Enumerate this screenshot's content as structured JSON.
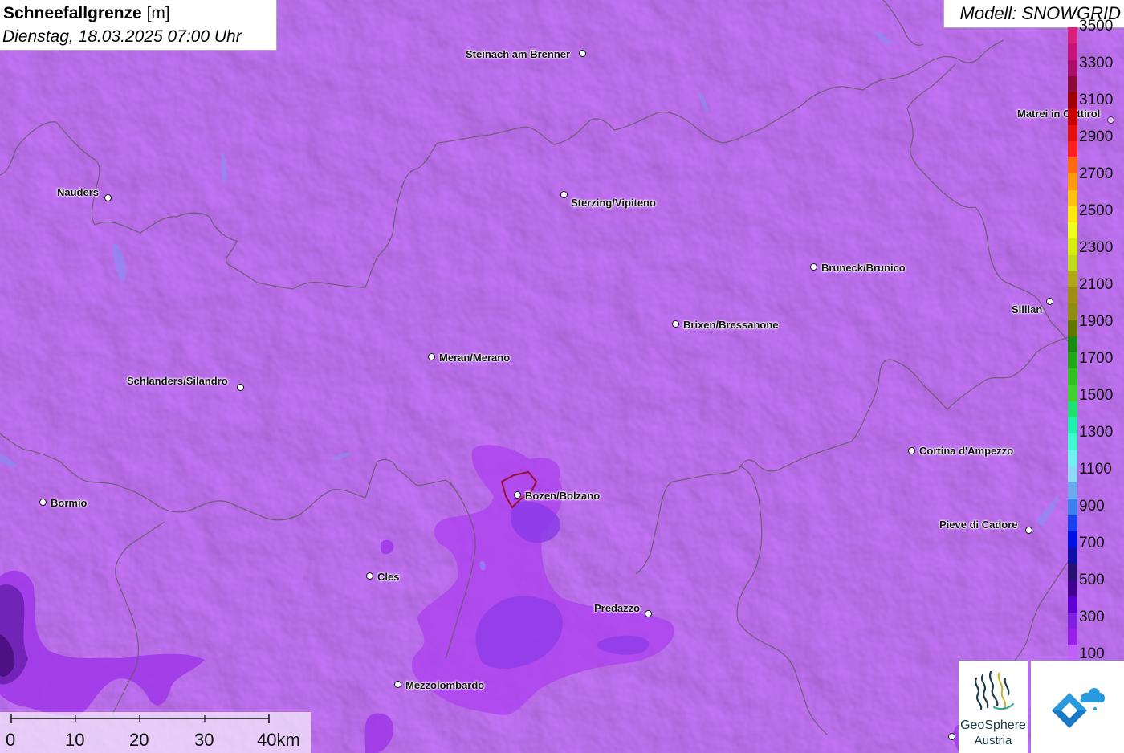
{
  "header": {
    "title_bold": "Schneefallgrenze",
    "title_unit": "[m]",
    "subtitle": "Dienstag, 18.03.2025 07:00 Uhr",
    "model": "Modell: SNOWGRID"
  },
  "cities": [
    {
      "name": "Steinach am Brenner",
      "id": "steinach"
    },
    {
      "name": "Matrei in Osttirol",
      "id": "matrei"
    },
    {
      "name": "Nauders",
      "id": "nauders"
    },
    {
      "name": "Sterzing/Vipiteno",
      "id": "sterzing"
    },
    {
      "name": "Bruneck/Brunico",
      "id": "bruneck"
    },
    {
      "name": "Sillian",
      "id": "sillian"
    },
    {
      "name": "Brixen/Bressanone",
      "id": "brixen"
    },
    {
      "name": "Meran/Merano",
      "id": "meran"
    },
    {
      "name": "Schlanders/Silandro",
      "id": "schlanders"
    },
    {
      "name": "Cortina d'Ampezzo",
      "id": "cortina"
    },
    {
      "name": "Bormio",
      "id": "bormio"
    },
    {
      "name": "Bozen/Bolzano",
      "id": "bozen"
    },
    {
      "name": "Pieve di Cadore",
      "id": "pieve"
    },
    {
      "name": "Cles",
      "id": "cles"
    },
    {
      "name": "Predazzo",
      "id": "predazzo"
    },
    {
      "name": "Mezzolombardo",
      "id": "mezzolombardo"
    }
  ],
  "legend": {
    "labels": [
      "3500",
      "3300",
      "3100",
      "2900",
      "2700",
      "2500",
      "2300",
      "2100",
      "1900",
      "1700",
      "1500",
      "1300",
      "1100",
      "900",
      "700",
      "500",
      "300",
      "100"
    ],
    "colors": [
      "#d8207f",
      "#c4157a",
      "#a80f6a",
      "#8a0a3a",
      "#a00000",
      "#c80000",
      "#e41010",
      "#ff2020",
      "#ff6a10",
      "#ff9a10",
      "#ffc010",
      "#ffe810",
      "#f0ff20",
      "#d8ec10",
      "#c0d820",
      "#b0a818",
      "#a08e10",
      "#908c10",
      "#607800",
      "#1a8a10",
      "#20a818",
      "#30c020",
      "#40d030",
      "#20e070",
      "#20f0b0",
      "#40f8d0",
      "#70f0f0",
      "#90d8f8",
      "#70a8f0",
      "#3a80f0",
      "#1a40f0",
      "#0010e0",
      "#1010a8",
      "#281070",
      "#400090",
      "#6000d0",
      "#8020e0",
      "#9820e8",
      "#c060f8"
    ]
  },
  "scalebar": {
    "labels": [
      "0",
      "10",
      "20",
      "30",
      "40km"
    ]
  },
  "logos": {
    "geosphere_line1": "GeoSphere",
    "geosphere_line2": "Austria"
  }
}
